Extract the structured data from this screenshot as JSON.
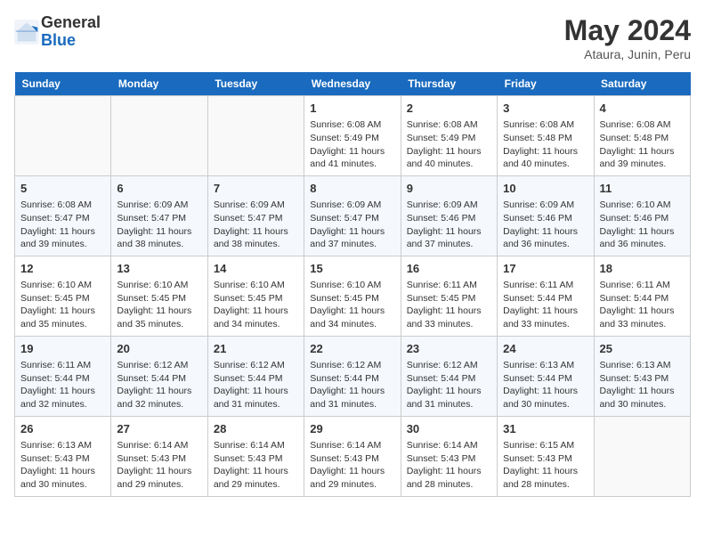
{
  "header": {
    "logo_general": "General",
    "logo_blue": "Blue",
    "month_year": "May 2024",
    "location": "Ataura, Junin, Peru"
  },
  "days_of_week": [
    "Sunday",
    "Monday",
    "Tuesday",
    "Wednesday",
    "Thursday",
    "Friday",
    "Saturday"
  ],
  "weeks": [
    [
      {
        "day": "",
        "info": ""
      },
      {
        "day": "",
        "info": ""
      },
      {
        "day": "",
        "info": ""
      },
      {
        "day": "1",
        "info": "Sunrise: 6:08 AM\nSunset: 5:49 PM\nDaylight: 11 hours and 41 minutes."
      },
      {
        "day": "2",
        "info": "Sunrise: 6:08 AM\nSunset: 5:49 PM\nDaylight: 11 hours and 40 minutes."
      },
      {
        "day": "3",
        "info": "Sunrise: 6:08 AM\nSunset: 5:48 PM\nDaylight: 11 hours and 40 minutes."
      },
      {
        "day": "4",
        "info": "Sunrise: 6:08 AM\nSunset: 5:48 PM\nDaylight: 11 hours and 39 minutes."
      }
    ],
    [
      {
        "day": "5",
        "info": "Sunrise: 6:08 AM\nSunset: 5:47 PM\nDaylight: 11 hours and 39 minutes."
      },
      {
        "day": "6",
        "info": "Sunrise: 6:09 AM\nSunset: 5:47 PM\nDaylight: 11 hours and 38 minutes."
      },
      {
        "day": "7",
        "info": "Sunrise: 6:09 AM\nSunset: 5:47 PM\nDaylight: 11 hours and 38 minutes."
      },
      {
        "day": "8",
        "info": "Sunrise: 6:09 AM\nSunset: 5:47 PM\nDaylight: 11 hours and 37 minutes."
      },
      {
        "day": "9",
        "info": "Sunrise: 6:09 AM\nSunset: 5:46 PM\nDaylight: 11 hours and 37 minutes."
      },
      {
        "day": "10",
        "info": "Sunrise: 6:09 AM\nSunset: 5:46 PM\nDaylight: 11 hours and 36 minutes."
      },
      {
        "day": "11",
        "info": "Sunrise: 6:10 AM\nSunset: 5:46 PM\nDaylight: 11 hours and 36 minutes."
      }
    ],
    [
      {
        "day": "12",
        "info": "Sunrise: 6:10 AM\nSunset: 5:45 PM\nDaylight: 11 hours and 35 minutes."
      },
      {
        "day": "13",
        "info": "Sunrise: 6:10 AM\nSunset: 5:45 PM\nDaylight: 11 hours and 35 minutes."
      },
      {
        "day": "14",
        "info": "Sunrise: 6:10 AM\nSunset: 5:45 PM\nDaylight: 11 hours and 34 minutes."
      },
      {
        "day": "15",
        "info": "Sunrise: 6:10 AM\nSunset: 5:45 PM\nDaylight: 11 hours and 34 minutes."
      },
      {
        "day": "16",
        "info": "Sunrise: 6:11 AM\nSunset: 5:45 PM\nDaylight: 11 hours and 33 minutes."
      },
      {
        "day": "17",
        "info": "Sunrise: 6:11 AM\nSunset: 5:44 PM\nDaylight: 11 hours and 33 minutes."
      },
      {
        "day": "18",
        "info": "Sunrise: 6:11 AM\nSunset: 5:44 PM\nDaylight: 11 hours and 33 minutes."
      }
    ],
    [
      {
        "day": "19",
        "info": "Sunrise: 6:11 AM\nSunset: 5:44 PM\nDaylight: 11 hours and 32 minutes."
      },
      {
        "day": "20",
        "info": "Sunrise: 6:12 AM\nSunset: 5:44 PM\nDaylight: 11 hours and 32 minutes."
      },
      {
        "day": "21",
        "info": "Sunrise: 6:12 AM\nSunset: 5:44 PM\nDaylight: 11 hours and 31 minutes."
      },
      {
        "day": "22",
        "info": "Sunrise: 6:12 AM\nSunset: 5:44 PM\nDaylight: 11 hours and 31 minutes."
      },
      {
        "day": "23",
        "info": "Sunrise: 6:12 AM\nSunset: 5:44 PM\nDaylight: 11 hours and 31 minutes."
      },
      {
        "day": "24",
        "info": "Sunrise: 6:13 AM\nSunset: 5:44 PM\nDaylight: 11 hours and 30 minutes."
      },
      {
        "day": "25",
        "info": "Sunrise: 6:13 AM\nSunset: 5:43 PM\nDaylight: 11 hours and 30 minutes."
      }
    ],
    [
      {
        "day": "26",
        "info": "Sunrise: 6:13 AM\nSunset: 5:43 PM\nDaylight: 11 hours and 30 minutes."
      },
      {
        "day": "27",
        "info": "Sunrise: 6:14 AM\nSunset: 5:43 PM\nDaylight: 11 hours and 29 minutes."
      },
      {
        "day": "28",
        "info": "Sunrise: 6:14 AM\nSunset: 5:43 PM\nDaylight: 11 hours and 29 minutes."
      },
      {
        "day": "29",
        "info": "Sunrise: 6:14 AM\nSunset: 5:43 PM\nDaylight: 11 hours and 29 minutes."
      },
      {
        "day": "30",
        "info": "Sunrise: 6:14 AM\nSunset: 5:43 PM\nDaylight: 11 hours and 28 minutes."
      },
      {
        "day": "31",
        "info": "Sunrise: 6:15 AM\nSunset: 5:43 PM\nDaylight: 11 hours and 28 minutes."
      },
      {
        "day": "",
        "info": ""
      }
    ]
  ]
}
